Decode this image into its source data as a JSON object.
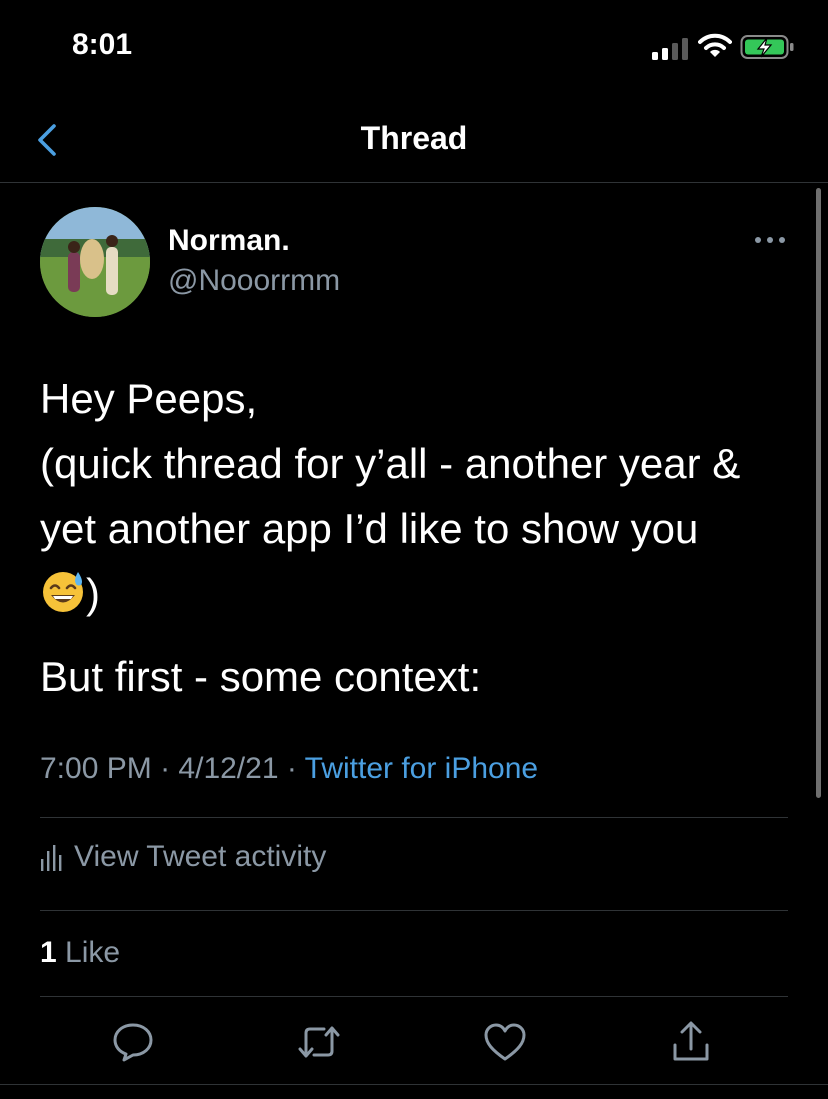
{
  "status_bar": {
    "time": "8:01"
  },
  "nav": {
    "title": "Thread"
  },
  "tweet": {
    "author_name": "Norman.",
    "author_handle": "@Nooorrmm",
    "line1": "Hey Peeps,",
    "line2": "(quick thread for y’all - another year &",
    "line3": "yet another app I’d like to show you",
    "line4_suffix": ")",
    "paragraph2": "But first - some context:",
    "time": "7:00 PM",
    "date": "4/12/21",
    "separator": "·",
    "source": "Twitter for iPhone",
    "activity_label": "View Tweet activity",
    "like_count": "1",
    "like_label": "Like"
  },
  "icons": [
    "back-chevron-icon",
    "more-options-icon",
    "activity-bars-icon",
    "reply-icon",
    "retweet-icon",
    "like-heart-icon",
    "share-icon",
    "sweat-smile-emoji"
  ],
  "colors": {
    "accent": "#4b9fe1",
    "secondary_text": "#8b98a5",
    "background": "#000000",
    "divider": "#2f3336"
  }
}
